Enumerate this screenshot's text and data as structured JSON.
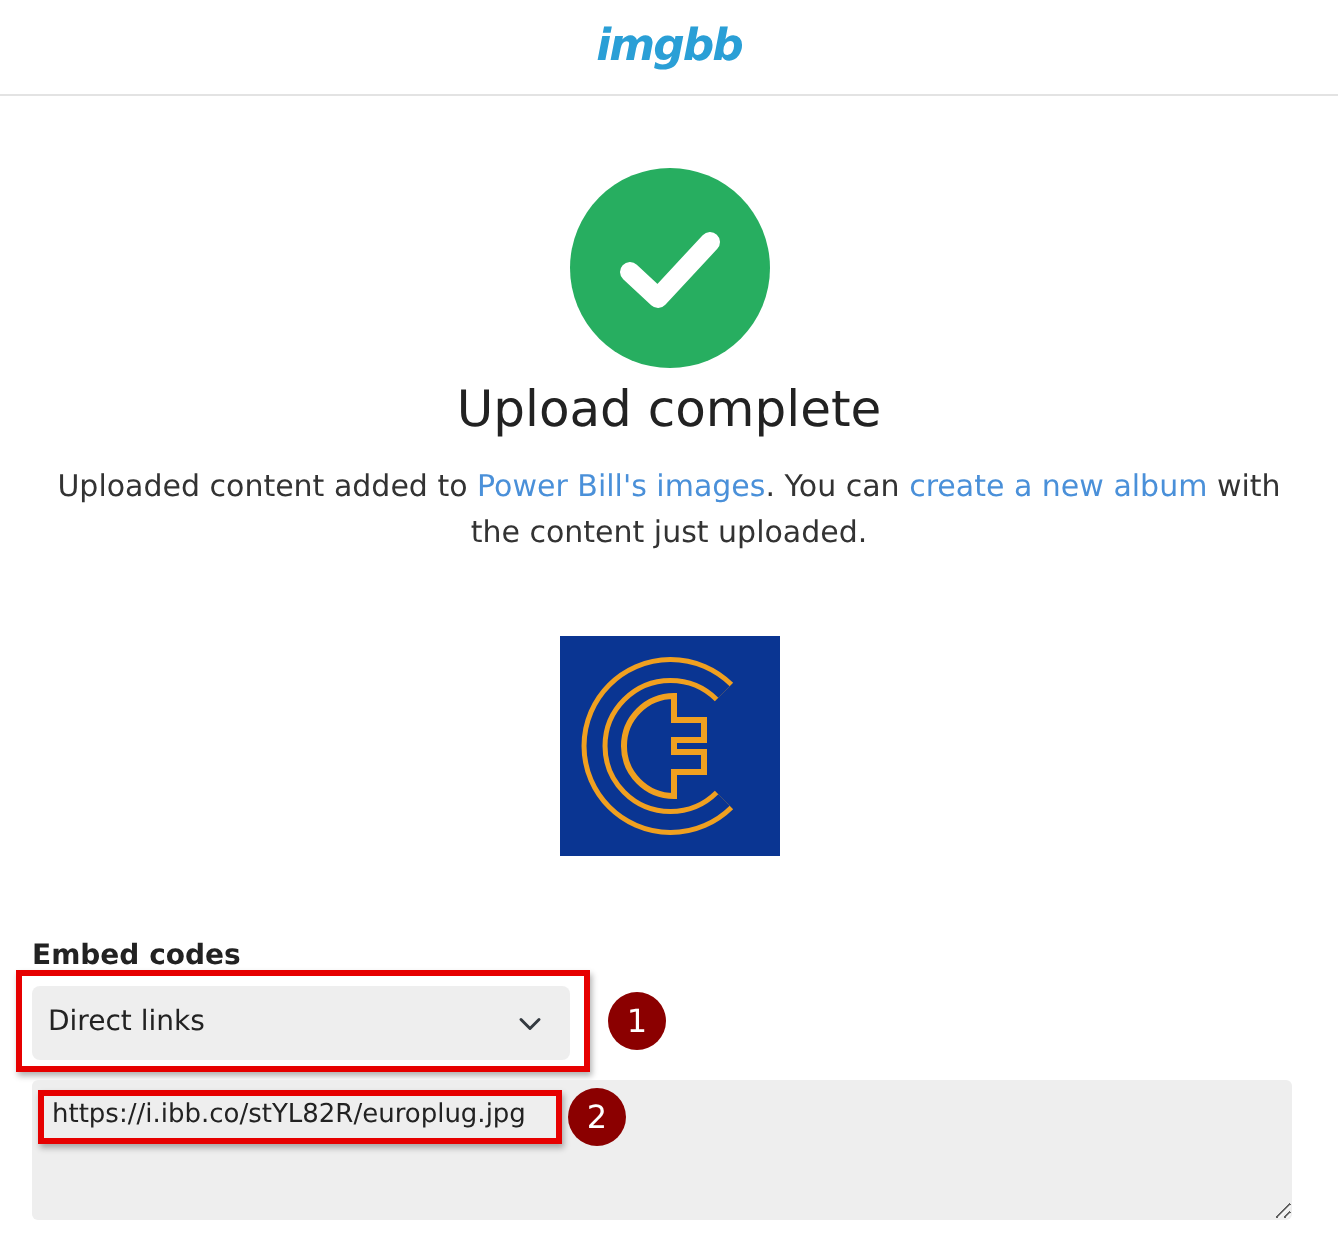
{
  "header": {
    "logo": "imgbb"
  },
  "status": {
    "kind": "success",
    "title": "Upload complete"
  },
  "message": [
    {
      "kind": "text",
      "text": "Uploaded content added to "
    },
    {
      "kind": "link",
      "text": "Power Bill's images"
    },
    {
      "kind": "text",
      "text": ". You can "
    },
    {
      "kind": "link",
      "text": "create a new album"
    },
    {
      "kind": "text",
      "text": " with the content just uploaded."
    }
  ],
  "embed": {
    "label": "Embed codes",
    "select_value": "Direct links",
    "select_callout": "1",
    "code": "https://i.ibb.co/stYL82R/europlug.jpg",
    "code_callout": "2"
  }
}
